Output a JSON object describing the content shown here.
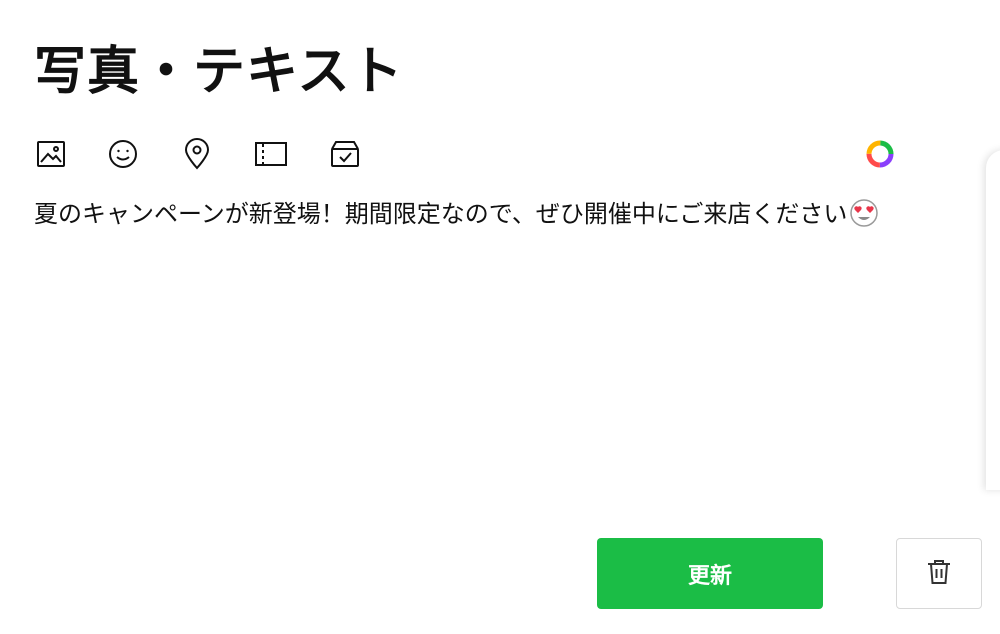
{
  "section": {
    "title": "写真・テキスト"
  },
  "toolbar": {
    "icons": [
      "image-icon",
      "emoji-icon",
      "location-icon",
      "coupon-icon",
      "shop-card-icon"
    ],
    "ai_icon": "ai-assist-icon"
  },
  "message": {
    "text": "夏のキャンペーンが新登場！期間限定なので、ぜひ開催中にご来店ください",
    "emoji": "heart-eyes-emoji"
  },
  "actions": {
    "update_label": "更新",
    "delete_icon": "trash-icon"
  },
  "colors": {
    "primary": "#1bbd46",
    "text": "#111111",
    "border": "#d8d8d8"
  }
}
